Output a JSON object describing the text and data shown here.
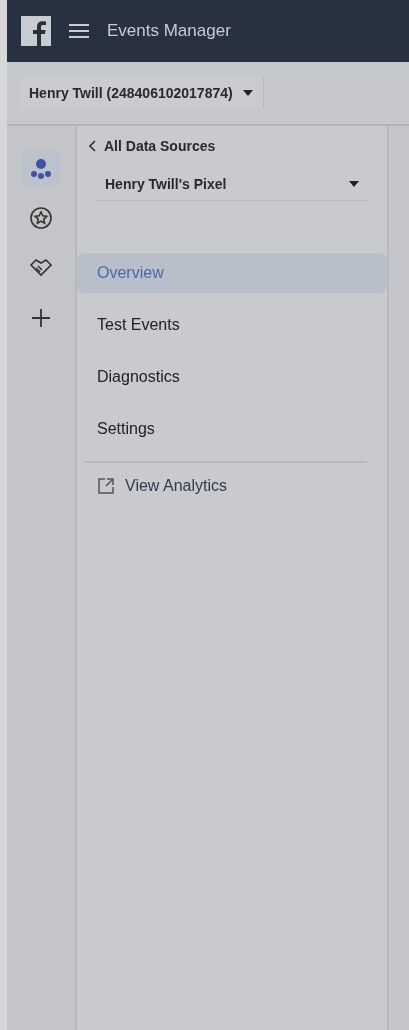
{
  "header": {
    "title": "Events Manager"
  },
  "account": {
    "label": "Henry Twill (248406102017874)"
  },
  "rail": [
    {
      "kind": "sources",
      "selected": true
    },
    {
      "kind": "star",
      "selected": false
    },
    {
      "kind": "handshake",
      "selected": false
    },
    {
      "kind": "add",
      "selected": false
    }
  ],
  "nav": {
    "back": "All Data Sources",
    "source": "Henry Twill's Pixel",
    "items": [
      {
        "label": "Overview",
        "selected": true
      },
      {
        "label": "Test Events",
        "selected": false
      },
      {
        "label": "Diagnostics",
        "selected": false
      },
      {
        "label": "Settings",
        "selected": false
      }
    ],
    "link": "View Analytics"
  }
}
